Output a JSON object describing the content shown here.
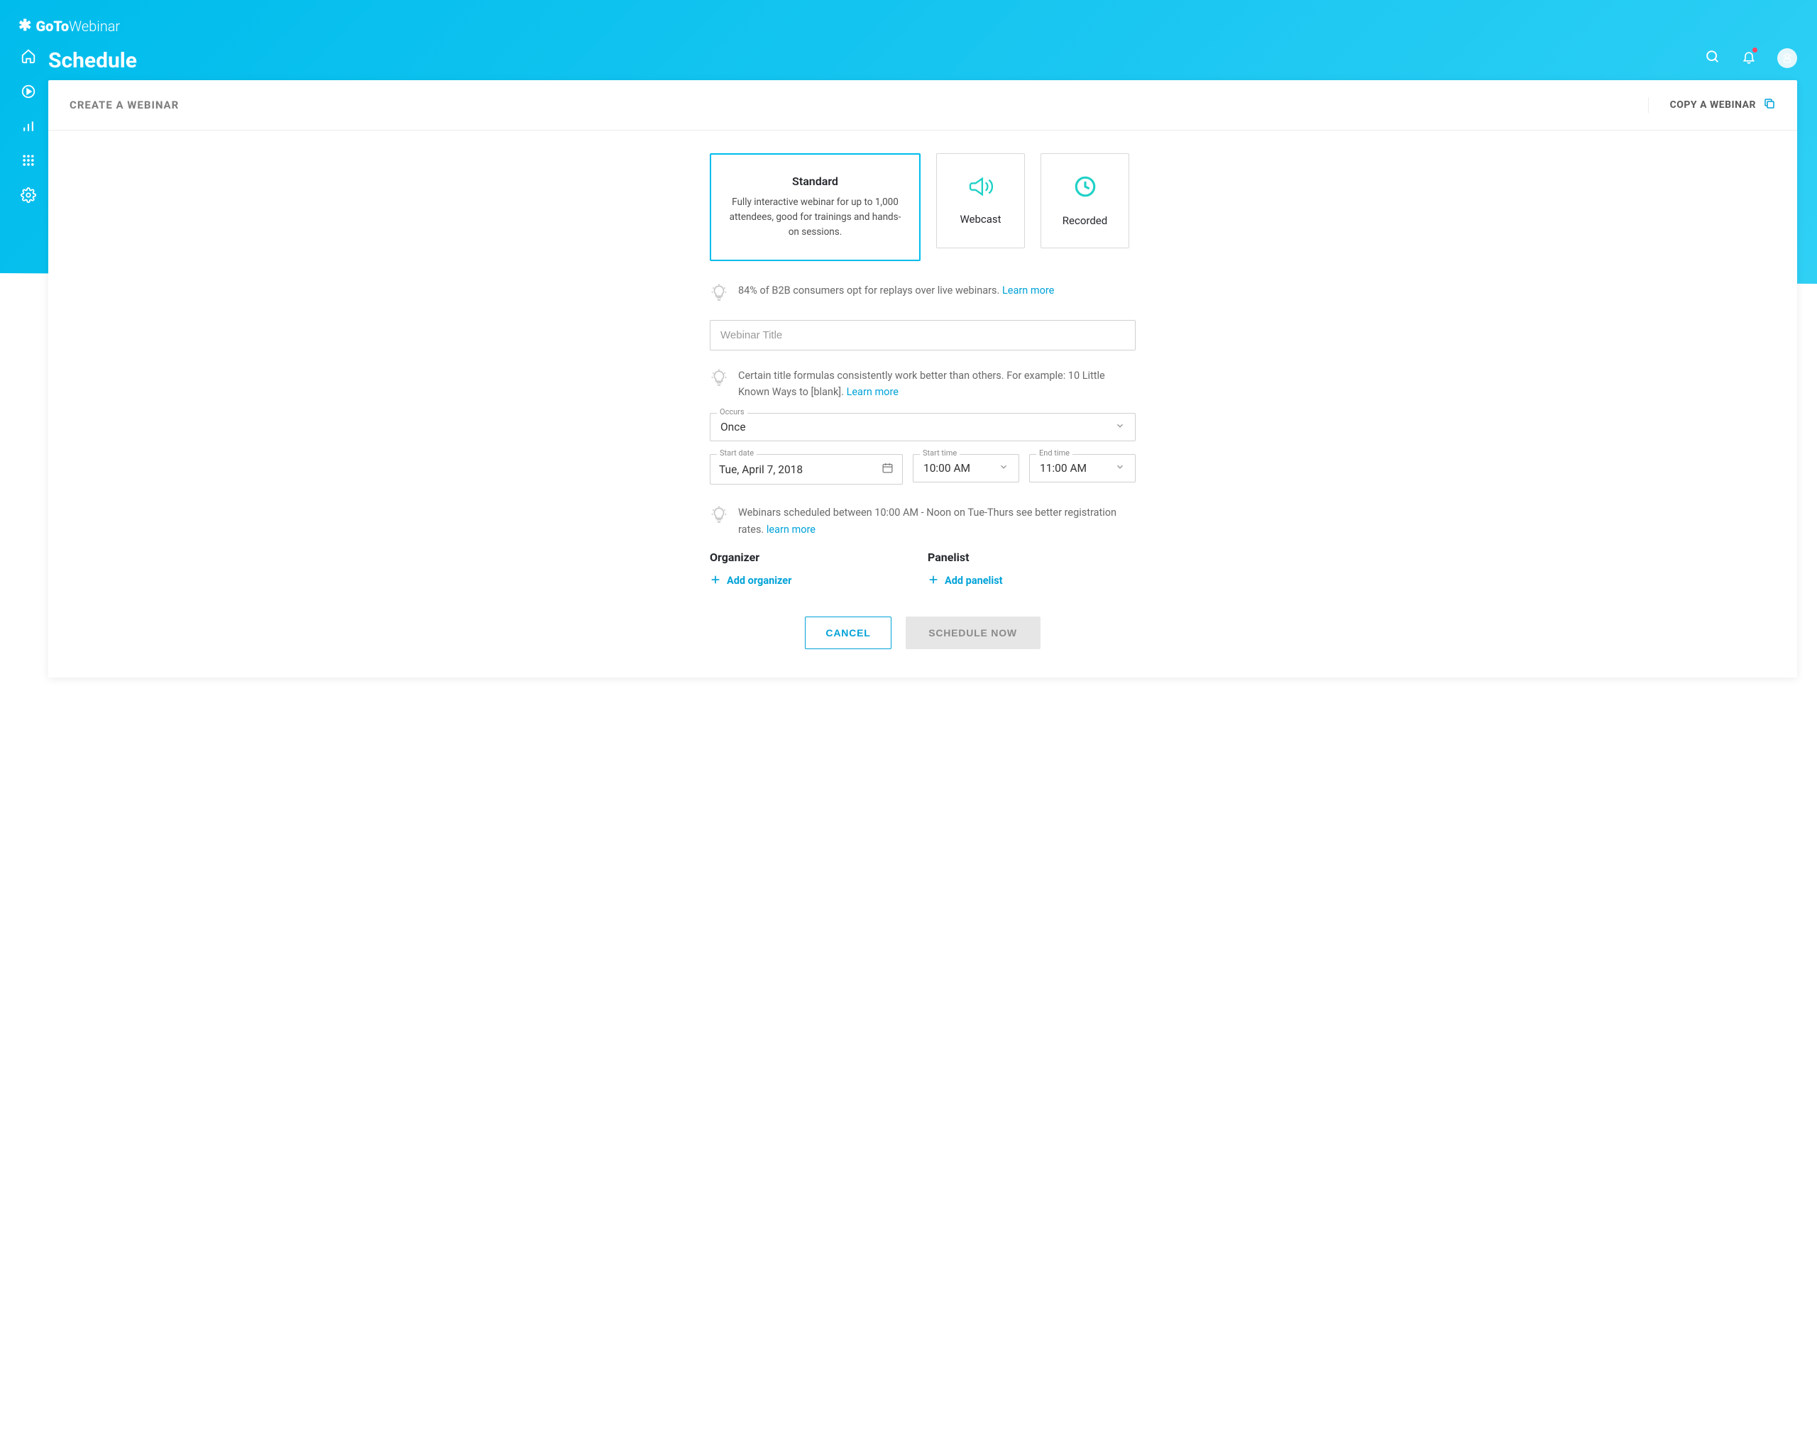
{
  "logo": {
    "brand_prefix": "GoTo",
    "brand_suffix": "Webinar"
  },
  "page_title": "Schedule",
  "card": {
    "header_left": "CREATE A WEBINAR",
    "header_right": "COPY A WEBINAR"
  },
  "types": {
    "standard": {
      "title": "Standard",
      "desc": "Fully interactive webinar for up to 1,000 attendees, good for trainings and hands-on sessions."
    },
    "webcast": {
      "label": "Webcast"
    },
    "recorded": {
      "label": "Recorded"
    }
  },
  "tips": {
    "t1": {
      "text": "84% of B2B consumers opt for replays over live webinars. ",
      "link": "Learn more"
    },
    "t2": {
      "text": "Certain title formulas consistently work better than others. For example: 10 Little Known Ways to [blank]. ",
      "link": "Learn more"
    },
    "t3": {
      "text": "Webinars scheduled between 10:00 AM - Noon on Tue-Thurs see better registration rates. ",
      "link": "learn more"
    }
  },
  "form": {
    "title_placeholder": "Webinar Title",
    "occurs_label": "Occurs",
    "occurs_value": "Once",
    "start_date_label": "Start date",
    "start_date_value": "Tue, April 7, 2018",
    "start_time_label": "Start time",
    "start_time_value": "10:00 AM",
    "end_time_label": "End time",
    "end_time_value": "11:00 AM"
  },
  "sections": {
    "organizer": {
      "title": "Organizer",
      "add": "Add organizer"
    },
    "panelist": {
      "title": "Panelist",
      "add": "Add panelist"
    }
  },
  "actions": {
    "cancel": "CANCEL",
    "schedule": "SCHEDULE NOW"
  }
}
